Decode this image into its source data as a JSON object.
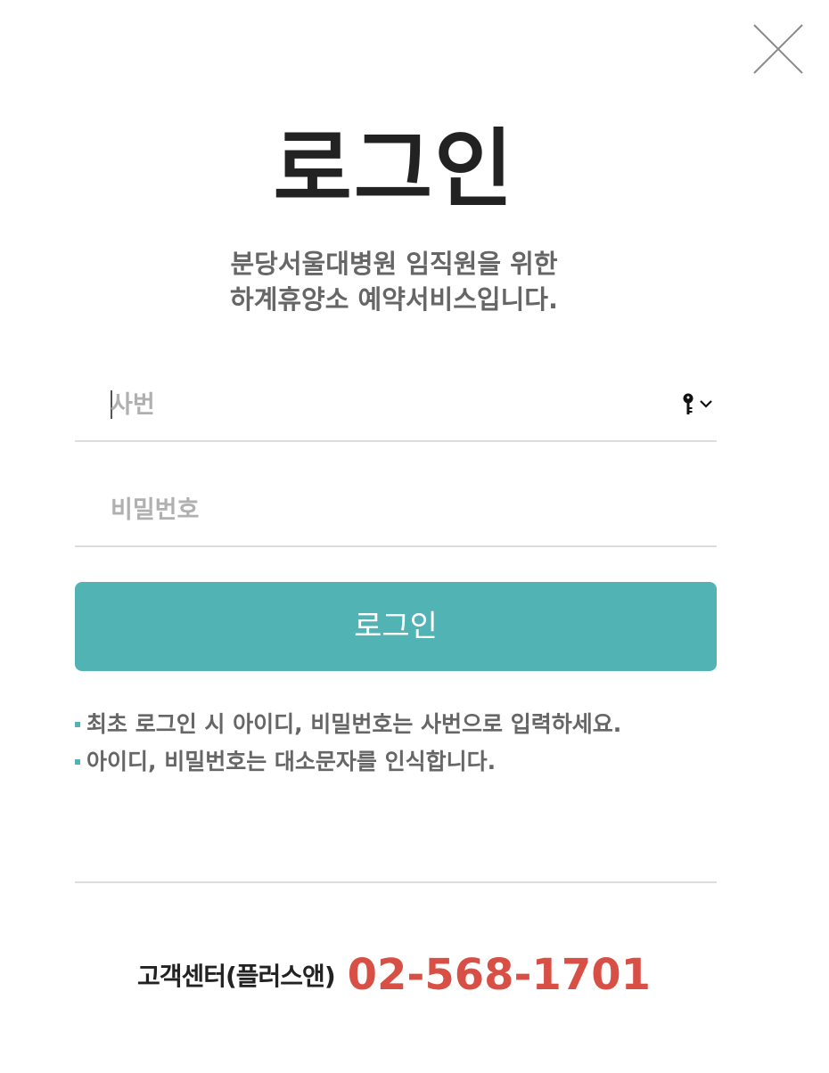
{
  "dialog": {
    "title": "로그인",
    "subtitle_lines": [
      "분당서울대병원 임직원을 위한",
      "하계휴양소 예약서비스입니다."
    ]
  },
  "form": {
    "id_placeholder": "사번",
    "password_placeholder": "비밀번호",
    "login_button": "로그인",
    "autofill_icon": "key-icon"
  },
  "notes": [
    "최초 로그인 시 아이디, 비밀번호는 사번으로 입력하세요.",
    "아이디, 비밀번호는 대소문자를 인식합니다."
  ],
  "contact": {
    "label": "고객센터(플러스앤)",
    "phone": "02-568-1701"
  },
  "colors": {
    "accent": "#52b3b4",
    "phone": "#d84f45",
    "title": "#222222",
    "subtext": "#666666",
    "placeholder": "#b0b0b0",
    "divider": "#dddddd"
  },
  "icons": {
    "close": "close-icon",
    "bullet": "square-bullet-icon"
  }
}
